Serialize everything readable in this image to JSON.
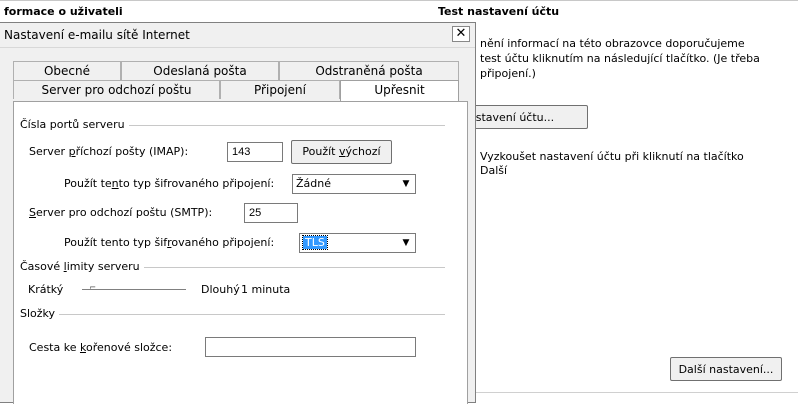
{
  "background": {
    "header_left": "formace o uživateli",
    "header_right": "Test nastavení účtu",
    "info_text": "nění informací na této obrazovce doporučujeme\n test účtu kliknutím na následující tlačítko. (Je třeba\npřipojení.)",
    "test_button": "astavení účtu...",
    "checkbox_text": "Vyzkoušet nastavení účtu při kliknutí na tlačítko\nDalší",
    "more_settings_button": "Další nastavení..."
  },
  "dialog": {
    "title": "Nastavení e-mailu sítě Internet",
    "close": "✕",
    "tabs_row1": [
      "Obecné",
      "Odeslaná pošta",
      "Odstraněná pošta"
    ],
    "tabs_row2": [
      "Server pro odchozí poštu",
      "Připojení",
      "Upřesnit"
    ],
    "active_tab": "Upřesnit",
    "ports_group": "Čísla portů serveru",
    "imap_label": "Server příchozí pošty (IMAP):",
    "imap_value": "143",
    "use_default_button": "Použít výchozí",
    "encryption_label_in": "Použít tento typ šifrovaného připojení:",
    "encryption_in_value": "Žádné",
    "smtp_label": "Server pro odchozí poštu (SMTP):",
    "smtp_value": "25",
    "encryption_label_out": "Použít tento typ šifrovaného připojení:",
    "encryption_out_value": "TLS",
    "timeouts_group": "Časové limity serveru",
    "timeout_short": "Krátký",
    "timeout_long": "Dlouhý",
    "timeout_value": "1 minuta",
    "timeout_level": 0.1,
    "folders_group": "Složky",
    "root_folder_label": "Cesta ke kořenové složce:",
    "root_folder_value": ""
  },
  "icons": {
    "dropdown": "chevron-down-icon",
    "close": "close-icon"
  }
}
